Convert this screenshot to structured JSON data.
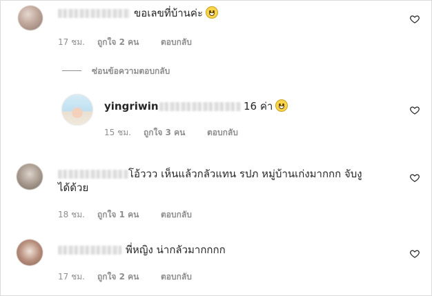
{
  "comments": [
    {
      "username": "",
      "text": "ขอเลขที่บ้านค่ะ",
      "emoji": "grinning-face-icon",
      "time": "17 ชม.",
      "likes": "ถูกใจ 2 คน",
      "reply_label": "ตอบกลับ"
    },
    {
      "username": "yingriwin",
      "text": "16 ค่า",
      "emoji": "grinning-face-icon",
      "time": "15 ชม.",
      "likes": "ถูกใจ 3 คน",
      "reply_label": "ตอบกลับ"
    },
    {
      "username": "",
      "text_line1": "โอ้ววว เห็นแล้วกลัวแทน รปภ หมู่บ้านเก่งมากกก จับงู",
      "text_line2": "ได้ด้วย",
      "time": "18 ชม.",
      "likes": "ถูกใจ 1 คน",
      "reply_label": "ตอบกลับ"
    },
    {
      "username": "",
      "text": "พี่หญิง น่ากลัวมากกกก",
      "time": "17 ชม.",
      "likes": "ถูกใจ 2 คน",
      "reply_label": "ตอบกลับ"
    }
  ],
  "hide_replies_label": "ซ่อนข้อความตอบกลับ",
  "icons": {
    "like": "heart-outline-icon"
  }
}
